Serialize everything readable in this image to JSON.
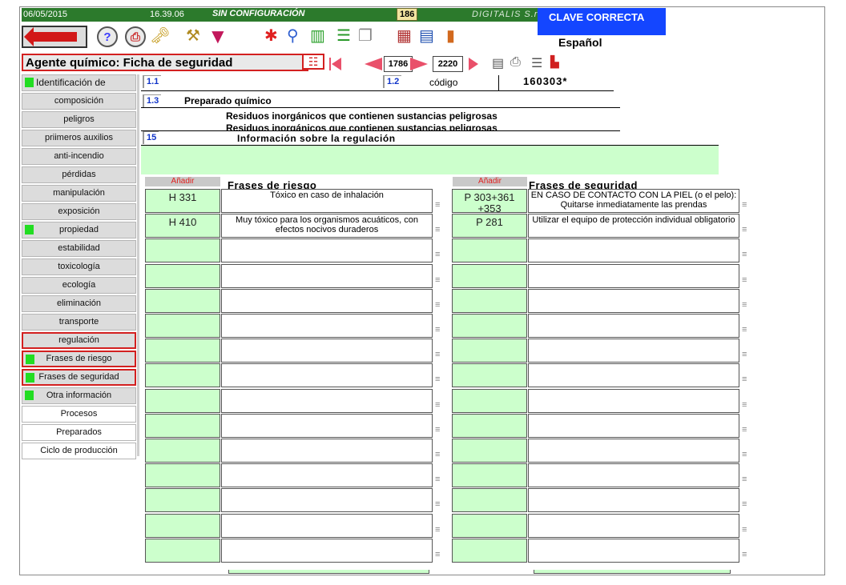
{
  "status": {
    "date": "06/05/2015",
    "time": "16.39.06",
    "config": "SIN CONFIGURACIÓN",
    "count": "186",
    "company": "DIGITALIS S.r.l.",
    "key_status": "CLAVE CORRECTA"
  },
  "toolbar": {
    "language": "Español",
    "icons": [
      "back-arrow-icon",
      "help-icon",
      "print-icon",
      "key-icon",
      "tools-icon",
      "funnel-icon",
      "snowflake-icon",
      "search-icon",
      "books-icon",
      "list-icon",
      "documents-icon",
      "film-icon",
      "chart-icon",
      "exit-door-icon"
    ]
  },
  "title": {
    "text": "Agente químico: Ficha de seguridad",
    "record_current": "1786",
    "record_total": "2220"
  },
  "nav": [
    {
      "label": "Identificación de",
      "mark": true,
      "style": "hdr"
    },
    {
      "label": "composición"
    },
    {
      "label": "peligros"
    },
    {
      "label": "priimeros auxilios"
    },
    {
      "label": "anti-incendio"
    },
    {
      "label": "pérdidas"
    },
    {
      "label": "manipulación"
    },
    {
      "label": "exposición"
    },
    {
      "label": "propiedad",
      "mark": true
    },
    {
      "label": "estabilidad"
    },
    {
      "label": "toxicología"
    },
    {
      "label": "ecología"
    },
    {
      "label": "eliminación"
    },
    {
      "label": "transporte"
    },
    {
      "label": "regulación",
      "active": true
    },
    {
      "label": "Frases de riesgo",
      "mark": true,
      "active": true
    },
    {
      "label": "Frases de seguridad",
      "mark": true,
      "active": true
    },
    {
      "label": "Otra información",
      "mark": true
    },
    {
      "label": "Procesos",
      "white": true
    },
    {
      "label": "Preparados",
      "white": true
    },
    {
      "label": "Ciclo de producción",
      "white": true
    }
  ],
  "section": {
    "n1_1": "1.1",
    "n1_2": "1.2",
    "code_label": "código",
    "code_value": "160303*",
    "n1_3": "1.3",
    "prep_label": "Preparado químico",
    "prep_line1": "Residuos inorgánicos que contienen sustancias peligrosas",
    "prep_line2": "Residuos inorgánicos que contienen sustancias peligrosas",
    "n15": "15",
    "reg_label": "Información sobre la regulación"
  },
  "risk": {
    "add_label": "Añadir",
    "title": "Frases de riesgo",
    "rows": [
      {
        "code": "H 331",
        "text": "Tóxico en caso de inhalación"
      },
      {
        "code": "H 410",
        "text": "Muy tóxico para los organismos acuáticos, con efectos nocivos duraderos"
      },
      {
        "code": "",
        "text": ""
      },
      {
        "code": "",
        "text": ""
      },
      {
        "code": "",
        "text": ""
      },
      {
        "code": "",
        "text": ""
      },
      {
        "code": "",
        "text": ""
      },
      {
        "code": "",
        "text": ""
      },
      {
        "code": "",
        "text": ""
      },
      {
        "code": "",
        "text": ""
      },
      {
        "code": "",
        "text": ""
      },
      {
        "code": "",
        "text": ""
      },
      {
        "code": "",
        "text": ""
      },
      {
        "code": "",
        "text": ""
      },
      {
        "code": "",
        "text": ""
      }
    ]
  },
  "safety": {
    "add_label": "Añadir",
    "title": "Frases de seguridad",
    "rows": [
      {
        "code": "P 303+361 +353",
        "text": "EN CASO DE CONTACTO CON LA PIEL (o el pelo): Quitarse inmediatamente las prendas"
      },
      {
        "code": "P 281",
        "text": "Utilizar el equipo de protección individual obligatorio"
      },
      {
        "code": "",
        "text": ""
      },
      {
        "code": "",
        "text": ""
      },
      {
        "code": "",
        "text": ""
      },
      {
        "code": "",
        "text": ""
      },
      {
        "code": "",
        "text": ""
      },
      {
        "code": "",
        "text": ""
      },
      {
        "code": "",
        "text": ""
      },
      {
        "code": "",
        "text": ""
      },
      {
        "code": "",
        "text": ""
      },
      {
        "code": "",
        "text": ""
      },
      {
        "code": "",
        "text": ""
      },
      {
        "code": "",
        "text": ""
      },
      {
        "code": "",
        "text": ""
      }
    ]
  },
  "colors": {
    "status_green": "#2c7a2c",
    "key_blue": "#1446ff",
    "field_green": "#ccffcc",
    "active_red": "#d32020"
  }
}
